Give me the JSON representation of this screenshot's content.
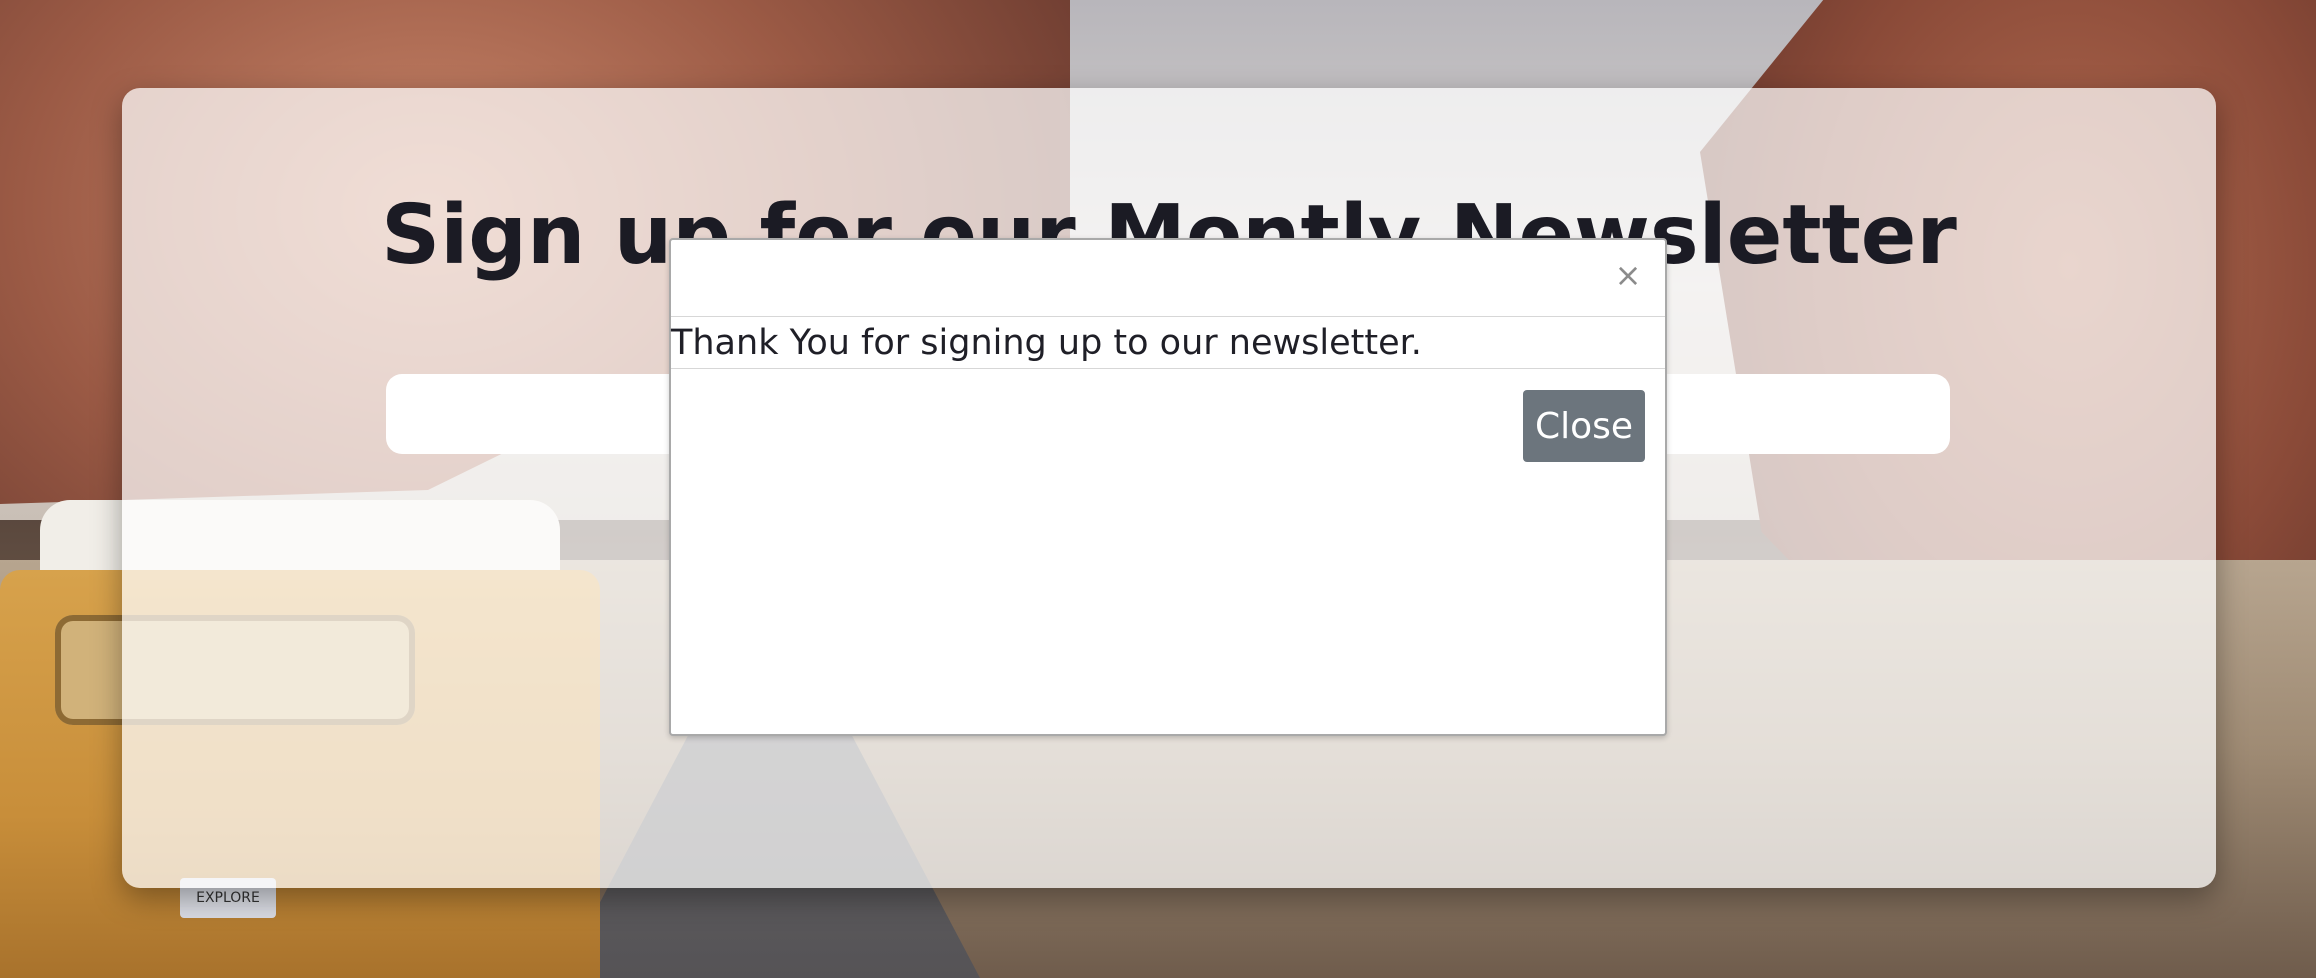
{
  "page": {
    "headline": "Sign up for our Montly Newsletter",
    "email_input": {
      "value": "",
      "placeholder": ""
    }
  },
  "background": {
    "van_plate_text": "EXPLORE"
  },
  "modal": {
    "close_icon": "close-icon",
    "close_x_label": "×",
    "message": "Thank You for signing up to our newsletter.",
    "close_button_label": "Close"
  },
  "colors": {
    "panel_bg": "#ffffff",
    "close_button": "#6c757d",
    "headline": "#1b1b24"
  }
}
